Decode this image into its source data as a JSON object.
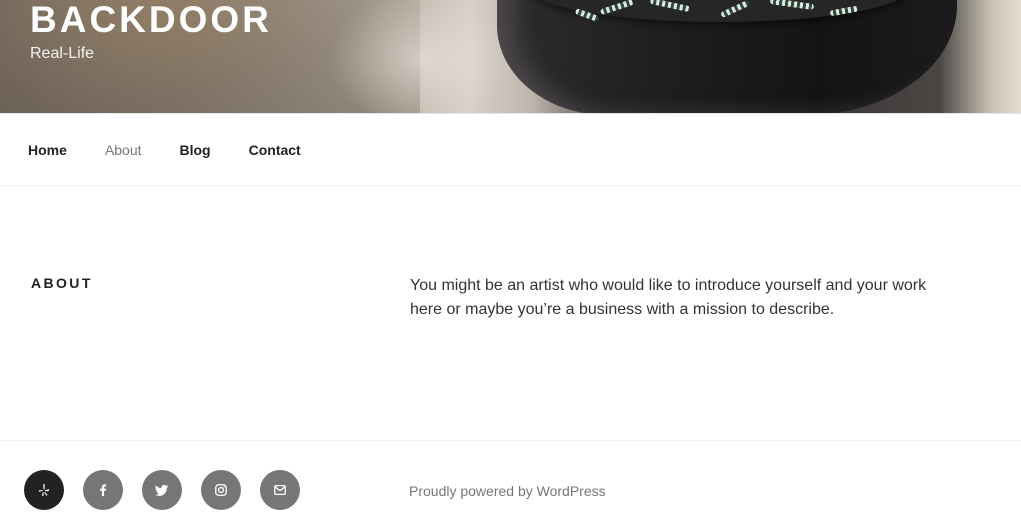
{
  "header": {
    "site_title": "BACKDOOR",
    "site_description": "Real-Life"
  },
  "nav": {
    "items": [
      {
        "label": "Home"
      },
      {
        "label": "About"
      },
      {
        "label": "Blog"
      },
      {
        "label": "Contact"
      }
    ],
    "current": "About"
  },
  "page": {
    "title": "ABOUT",
    "body": "You might be an artist who would like to introduce yourself and your work here or maybe you’re a business with a mission to describe."
  },
  "footer": {
    "social_icons": [
      "yelp-icon",
      "facebook-icon",
      "twitter-icon",
      "instagram-icon",
      "email-icon"
    ],
    "powered_by": "Proudly powered by WordPress"
  },
  "colors": {
    "text_dark": "#222222",
    "text_muted": "#767676",
    "social_bg": "#767676",
    "social_bg_active": "#222222"
  }
}
